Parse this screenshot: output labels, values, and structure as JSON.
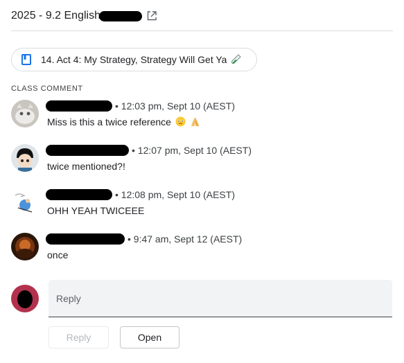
{
  "header": {
    "title": "2025 - 9.2 English",
    "open_icon": "external-link-icon"
  },
  "material": {
    "icon": "book-icon",
    "label": "14. Act 4: My Strategy, Strategy Will Get Ya",
    "trailing_icon": "test-tube-icon"
  },
  "section_label": "CLASS COMMENT",
  "comments": [
    {
      "author_redacted": true,
      "timestamp": "• 12:03 pm, Sept 10 (AEST)",
      "text": "Miss is this a twice reference",
      "emojis": [
        "teary-face-emoji",
        "folded-hands-emoji"
      ]
    },
    {
      "author_redacted": true,
      "timestamp": "• 12:07 pm, Sept 10 (AEST)",
      "text": "twice mentioned?!"
    },
    {
      "author_redacted": true,
      "timestamp": "• 12:08 pm, Sept 10 (AEST)",
      "text": "OHH YEAH TWICEEE"
    },
    {
      "author_redacted": true,
      "timestamp": "• 9:47 am, Sept 12 (AEST)",
      "text": "once"
    }
  ],
  "reply": {
    "placeholder": "Reply",
    "reply_button": "Reply",
    "open_button": "Open"
  },
  "colors": {
    "divider": "#dadce0",
    "reply_avatar": "#b2324d",
    "book_icon": "#1a73e8"
  }
}
